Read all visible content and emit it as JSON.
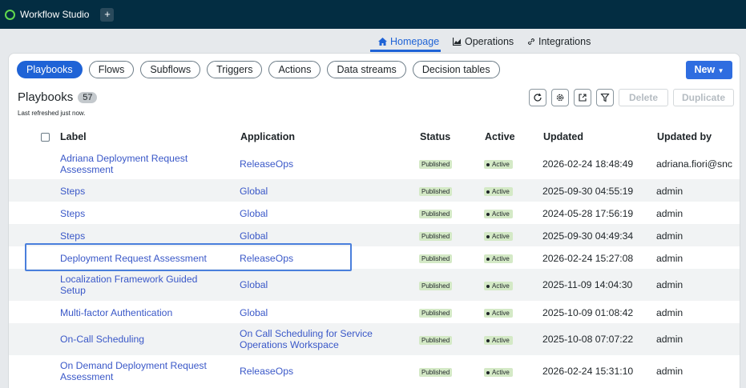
{
  "app": {
    "title": "Workflow Studio",
    "add_tab": "+"
  },
  "nav": {
    "tabs": [
      {
        "label": "Homepage",
        "icon": "home-icon",
        "active": true
      },
      {
        "label": "Operations",
        "icon": "chart-icon",
        "active": false
      },
      {
        "label": "Integrations",
        "icon": "link-icon",
        "active": false
      }
    ]
  },
  "filters": {
    "chips": [
      "Playbooks",
      "Flows",
      "Subflows",
      "Triggers",
      "Actions",
      "Data streams",
      "Decision tables"
    ],
    "active": "Playbooks"
  },
  "new_button": "New",
  "section": {
    "title": "Playbooks",
    "count": "57",
    "refreshed": "Last refreshed just now."
  },
  "toolbar": {
    "delete": "Delete",
    "duplicate": "Duplicate"
  },
  "columns": [
    "Label",
    "Application",
    "Status",
    "Active",
    "Updated",
    "Updated by"
  ],
  "rows": [
    {
      "label": "Adriana Deployment Request Assessment",
      "application": "ReleaseOps",
      "status": "Published",
      "active": "Active",
      "updated": "2026-02-24 18:48:49",
      "updated_by": "adriana.fiori@snc"
    },
    {
      "label": "Steps",
      "application": "Global",
      "status": "Published",
      "active": "Active",
      "updated": "2025-09-30 04:55:19",
      "updated_by": "admin"
    },
    {
      "label": "Steps",
      "application": "Global",
      "status": "Published",
      "active": "Active",
      "updated": "2024-05-28 17:56:19",
      "updated_by": "admin"
    },
    {
      "label": "Steps",
      "application": "Global",
      "status": "Published",
      "active": "Active",
      "updated": "2025-09-30 04:49:34",
      "updated_by": "admin"
    },
    {
      "label": "Deployment Request Assessment",
      "application": "ReleaseOps",
      "status": "Published",
      "active": "Active",
      "updated": "2026-02-24 15:27:08",
      "updated_by": "admin"
    },
    {
      "label": "Localization Framework Guided Setup",
      "application": "Global",
      "status": "Published",
      "active": "Active",
      "updated": "2025-11-09 14:04:30",
      "updated_by": "admin"
    },
    {
      "label": "Multi-factor Authentication",
      "application": "Global",
      "status": "Published",
      "active": "Active",
      "updated": "2025-10-09 01:08:42",
      "updated_by": "admin"
    },
    {
      "label": "On-Call Scheduling",
      "application": "On Call Scheduling for Service Operations Workspace",
      "status": "Published",
      "active": "Active",
      "updated": "2025-10-08 07:07:22",
      "updated_by": "admin"
    },
    {
      "label": "On Demand Deployment Request Assessment",
      "application": "ReleaseOps",
      "status": "Published",
      "active": "Active",
      "updated": "2026-02-24 15:31:10",
      "updated_by": "admin"
    }
  ]
}
